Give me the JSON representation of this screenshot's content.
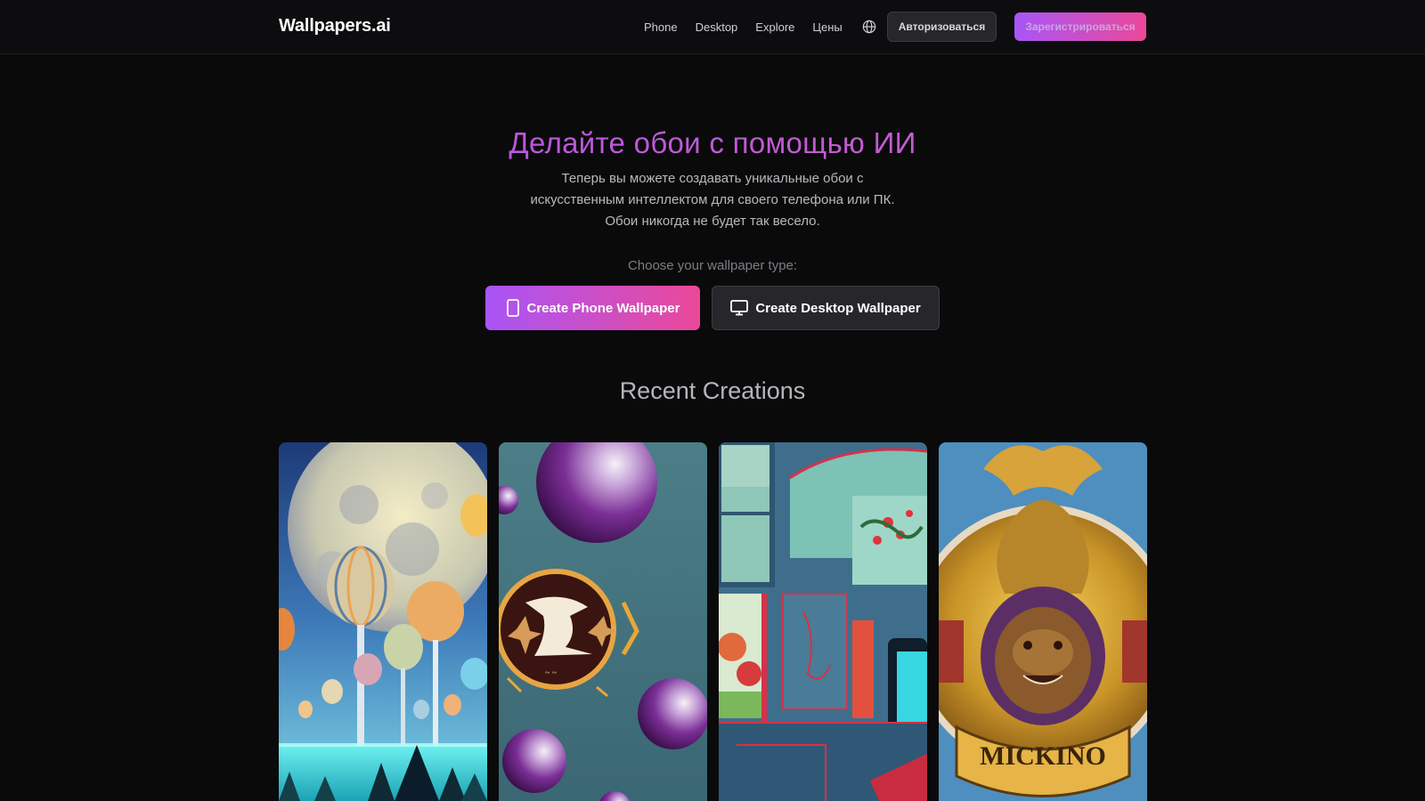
{
  "header": {
    "logo": "Wallpapers.ai",
    "nav": [
      {
        "label": "Phone"
      },
      {
        "label": "Desktop"
      },
      {
        "label": "Explore"
      },
      {
        "label": "Цены"
      }
    ],
    "language_icon": "globe-icon",
    "login_label": "Авторизоваться",
    "signup_label": "Зарегистрироваться"
  },
  "hero": {
    "title": "Делайте обои с помощью ИИ",
    "subtitle_lines": [
      "Теперь вы можете создавать уникальные обои с",
      "искусственным интеллектом для своего телефона или ПК.",
      "Обои никогда не будет так весело."
    ],
    "choose_label": "Choose your wallpaper type:",
    "phone_button": "Create Phone Wallpaper",
    "desktop_button": "Create Desktop Wallpaper",
    "phone_icon": "phone-icon",
    "desktop_icon": "monitor-icon"
  },
  "recent": {
    "title": "Recent Creations",
    "cards": [
      {
        "name": "moon-balloons-wallpaper"
      },
      {
        "name": "purple-spheres-emblem-wallpaper"
      },
      {
        "name": "retro-room-wallpaper"
      },
      {
        "name": "golden-crest-wallpaper"
      }
    ]
  },
  "colors": {
    "accent_start": "#a855f7",
    "accent_end": "#ec4899",
    "background": "#0a0a0b"
  }
}
